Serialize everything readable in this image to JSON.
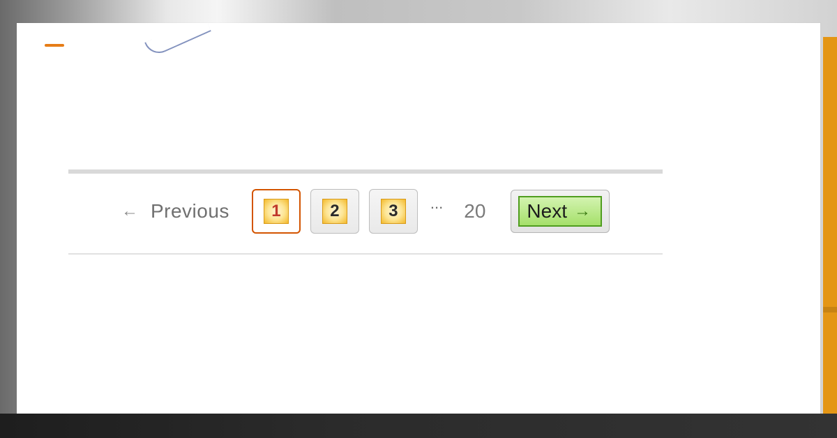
{
  "pagination": {
    "previous_label": "Previous",
    "previous_arrow": "←",
    "pages": [
      "1",
      "2",
      "3"
    ],
    "current_page": "1",
    "ellipsis": "...",
    "last_page": "20",
    "next_label": "Next",
    "next_arrow": "→"
  },
  "colors": {
    "accent_orange": "#e49615",
    "current_border": "#d35400",
    "next_green": "#6fb936"
  }
}
